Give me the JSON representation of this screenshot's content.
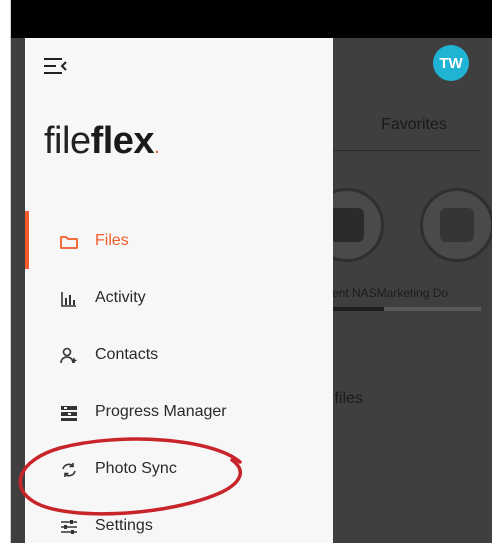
{
  "header": {
    "avatar_initials": "TW"
  },
  "logo": {
    "part1": "file",
    "part2": "flex",
    "dot": "."
  },
  "nav": {
    "items": [
      {
        "label": "Files",
        "icon": "folder-icon",
        "active": true
      },
      {
        "label": "Activity",
        "icon": "bar-chart-icon",
        "active": false
      },
      {
        "label": "Contacts",
        "icon": "add-person-icon",
        "active": false
      },
      {
        "label": "Progress Manager",
        "icon": "progress-list-icon",
        "active": false
      },
      {
        "label": "Photo Sync",
        "icon": "sync-icon",
        "active": false
      },
      {
        "label": "Settings",
        "icon": "sliders-icon",
        "active": false
      }
    ]
  },
  "content": {
    "tab_label": "Favorites",
    "storage_text": "ment NASMarketing Do",
    "section_label_partial": "v files"
  },
  "colors": {
    "accent": "#f25c2a",
    "avatar": "#1fb4d3",
    "annotation": "#c8252b"
  }
}
